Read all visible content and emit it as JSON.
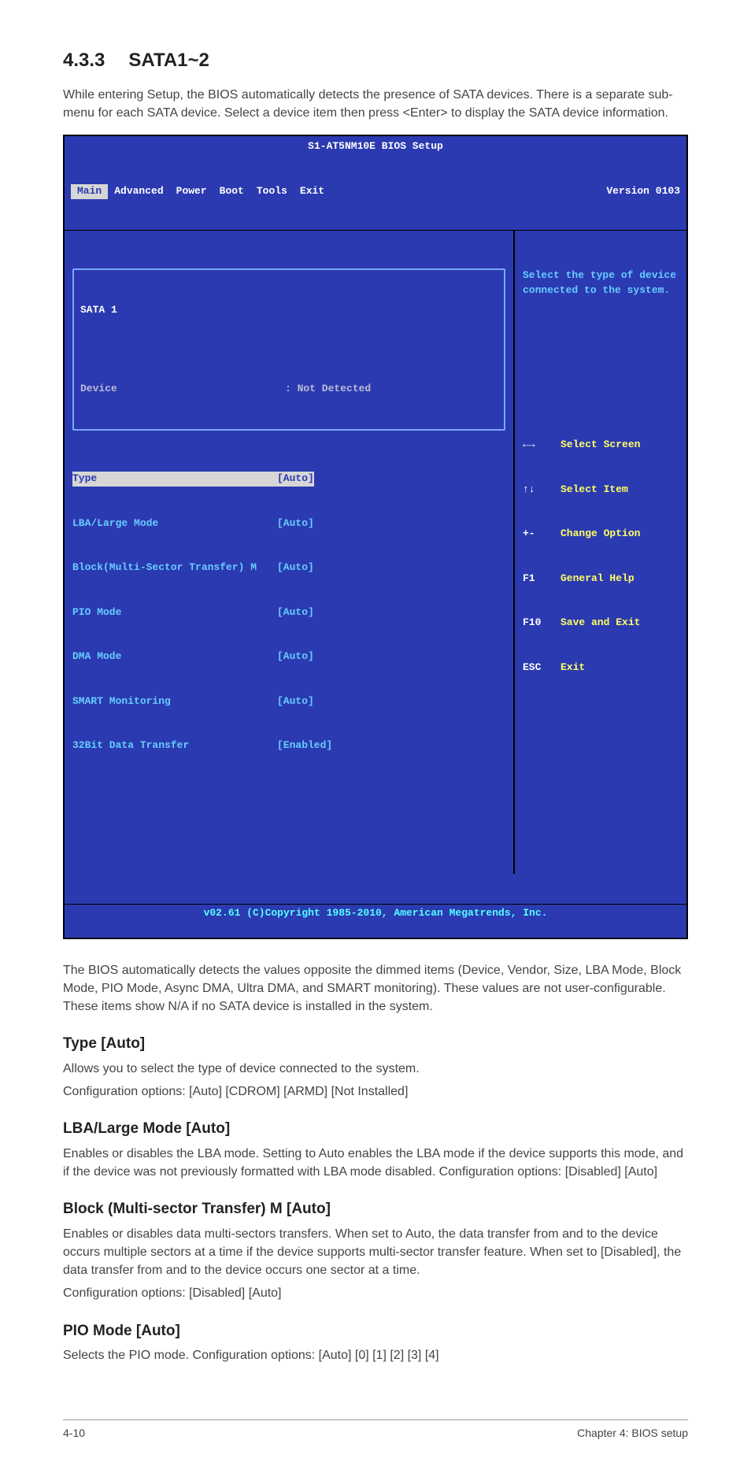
{
  "section": {
    "number": "4.3.3",
    "title": "SATA1~2"
  },
  "intro": "While entering Setup, the BIOS automatically detects the presence of SATA devices. There is a separate sub-menu for each SATA device. Select a device item then press <Enter> to display the SATA device information.",
  "bios": {
    "title": "S1-AT5NM10E BIOS Setup",
    "version": "Version 0103",
    "tabs": [
      "Main",
      "Advanced",
      "Power",
      "Boot",
      "Tools",
      "Exit"
    ],
    "active_tab": "Main",
    "panel_title": "SATA 1",
    "device_label": "Device",
    "device_value": ": Not Detected",
    "rows": [
      {
        "label": "Type",
        "value": "[Auto]",
        "highlight": true
      },
      {
        "label": "LBA/Large Mode",
        "value": "[Auto]"
      },
      {
        "label": "Block(Multi-Sector Transfer) M",
        "value": "[Auto]"
      },
      {
        "label": "PIO Mode",
        "value": "[Auto]"
      },
      {
        "label": "DMA Mode",
        "value": "[Auto]"
      },
      {
        "label": "SMART Monitoring",
        "value": "[Auto]"
      },
      {
        "label": "32Bit Data Transfer",
        "value": "[Enabled]"
      }
    ],
    "help": "Select the type of device connected to the system.",
    "nav": [
      {
        "key": "←→",
        "desc": "Select Screen"
      },
      {
        "key": "↑↓",
        "desc": "Select Item"
      },
      {
        "key": "+-",
        "desc": "Change Option"
      },
      {
        "key": "F1",
        "desc": "General Help"
      },
      {
        "key": "F10",
        "desc": "Save and Exit"
      },
      {
        "key": "ESC",
        "desc": "Exit"
      }
    ],
    "footer": "v02.61 (C)Copyright 1985-2010, American Megatrends, Inc."
  },
  "after_bios": "The BIOS automatically detects the values opposite the dimmed items (Device, Vendor, Size, LBA Mode, Block Mode, PIO Mode, Async DMA, Ultra DMA, and SMART monitoring). These values are not user-configurable. These items show N/A if no SATA device is installed in the system.",
  "subs": {
    "type": {
      "h": "Type [Auto]",
      "p1": "Allows you to select the type of device connected to the system.",
      "p2": "Configuration options: [Auto] [CDROM] [ARMD] [Not Installed]"
    },
    "lba": {
      "h": "LBA/Large Mode [Auto]",
      "p": "Enables or disables the LBA mode. Setting to Auto enables the LBA mode if the device supports this mode, and if the device was not previously formatted with LBA mode disabled. Configuration options: [Disabled] [Auto]"
    },
    "block": {
      "h": "Block (Multi-sector Transfer) M [Auto]",
      "p1": "Enables or disables data multi-sectors transfers. When set to Auto, the data transfer from and to the device occurs multiple sectors at a time if the device supports multi-sector transfer feature. When set to [Disabled], the data transfer from and to the device occurs one sector at a time.",
      "p2": "Configuration options: [Disabled] [Auto]"
    },
    "pio": {
      "h": "PIO Mode [Auto]",
      "p": "Selects the PIO mode. Configuration options: [Auto] [0] [1] [2] [3] [4]"
    }
  },
  "footer": {
    "left": "4-10",
    "right": "Chapter 4: BIOS setup"
  }
}
